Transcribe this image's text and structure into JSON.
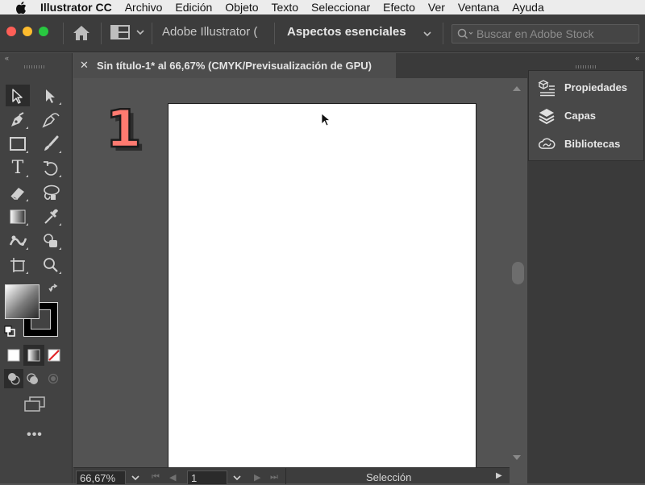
{
  "menu_bar": {
    "apple": "apple-icon",
    "items": [
      "Illustrator CC",
      "Archivo",
      "Edición",
      "Objeto",
      "Texto",
      "Seleccionar",
      "Efecto",
      "Ver",
      "Ventana",
      "Ayuda"
    ]
  },
  "app_bar": {
    "traffic_lights": {
      "close": "#fe5f57",
      "minimize": "#febc2e",
      "maximize": "#28c840"
    },
    "home_icon": "home-icon",
    "layout_icon": "arrange-documents-icon",
    "doc_switcher": "Adobe Illustrator (",
    "workspace": "Aspectos esenciales",
    "search_placeholder": "Buscar en Adobe Stock"
  },
  "document_tab": {
    "close": "✕",
    "title": "Sin título-1* al 66,67% (CMYK/Previsualización de GPU)"
  },
  "canvas": {
    "step_number": "1",
    "step_color": "#ff7a70"
  },
  "status_bar": {
    "zoom": "66,67%",
    "artboard": "1",
    "status": "Selección"
  },
  "tools": {
    "selection": "selection-tool-icon",
    "direct_selection": "direct-selection-tool-icon",
    "pen": "pen-tool-icon",
    "curvature": "curvature-tool-icon",
    "rectangle": "rectangle-tool-icon",
    "paintbrush": "paintbrush-tool-icon",
    "type": "T",
    "rotate": "rotate-tool-icon",
    "eraser": "eraser-tool-icon",
    "lasso": "lasso-tool-icon",
    "gradient": "gradient-tool-icon",
    "eyedropper": "eyedropper-tool-icon",
    "puppet_warp": "puppet-warp-tool-icon",
    "shape_builder": "shape-builder-tool-icon",
    "artboard": "artboard-tool-icon",
    "zoom": "zoom-tool-icon",
    "more": "•••"
  },
  "right_panel": {
    "items": [
      {
        "label": "Propiedades",
        "icon": "properties-icon"
      },
      {
        "label": "Capas",
        "icon": "layers-icon"
      },
      {
        "label": "Bibliotecas",
        "icon": "libraries-icon"
      }
    ]
  }
}
